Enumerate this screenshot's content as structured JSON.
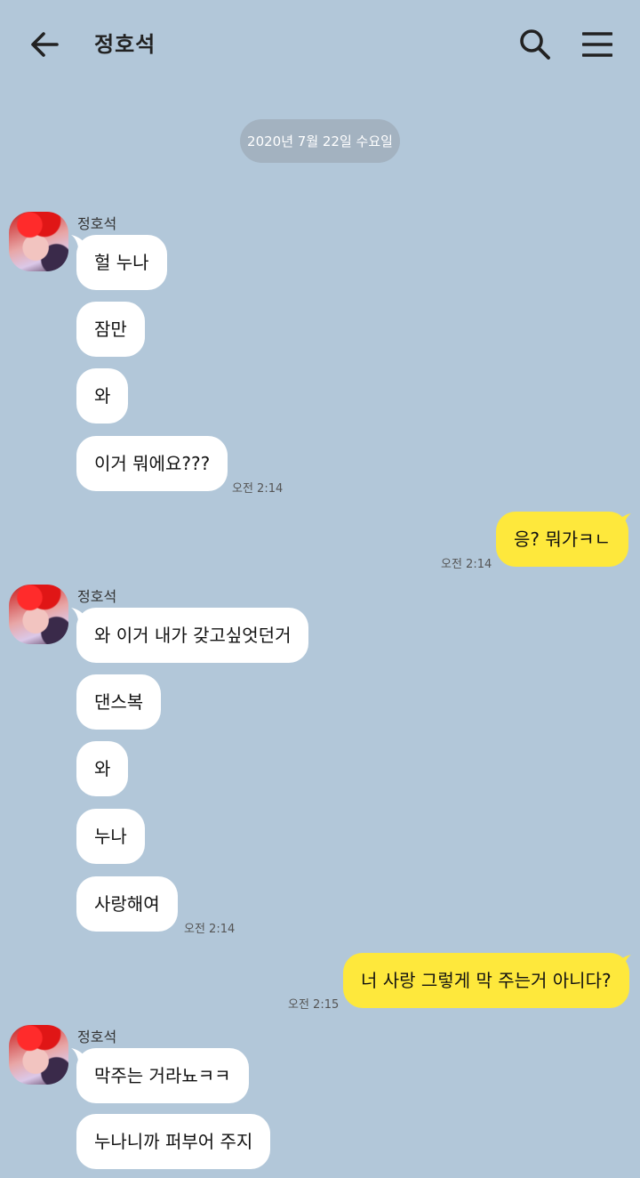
{
  "header": {
    "title": "정호석",
    "back_icon": "arrow-left-icon",
    "search_icon": "search-icon",
    "menu_icon": "hamburger-menu-icon"
  },
  "date_divider": "2020년 7월 22일 수요일",
  "sender_name": "정호석",
  "colors": {
    "background": "#b2c7d9",
    "incoming_bubble": "#ffffff",
    "outgoing_bubble": "#fee83c",
    "date_pill": "#a3b2c0"
  },
  "messages": [
    {
      "dir": "in",
      "text": "헐 누나"
    },
    {
      "dir": "in",
      "text": "잠만"
    },
    {
      "dir": "in",
      "text": "와"
    },
    {
      "dir": "in",
      "text": "이거 뭐에요???",
      "time": "오전 2:14"
    },
    {
      "dir": "out",
      "text": "응? 뭐가ㅋㄴ",
      "time": "오전 2:14"
    },
    {
      "dir": "in",
      "text": "와 이거 내가 갖고싶엇던거"
    },
    {
      "dir": "in",
      "text": "댄스복"
    },
    {
      "dir": "in",
      "text": "와"
    },
    {
      "dir": "in",
      "text": "누나"
    },
    {
      "dir": "in",
      "text": "사랑해여",
      "time": "오전 2:14"
    },
    {
      "dir": "out",
      "text": "너 사랑 그렇게 막 주는거 아니다?",
      "time": "오전 2:15"
    },
    {
      "dir": "in",
      "text": "막주는 거라뇨ㅋㅋ"
    },
    {
      "dir": "in",
      "text": "누나니까 퍼부어 주지"
    }
  ]
}
